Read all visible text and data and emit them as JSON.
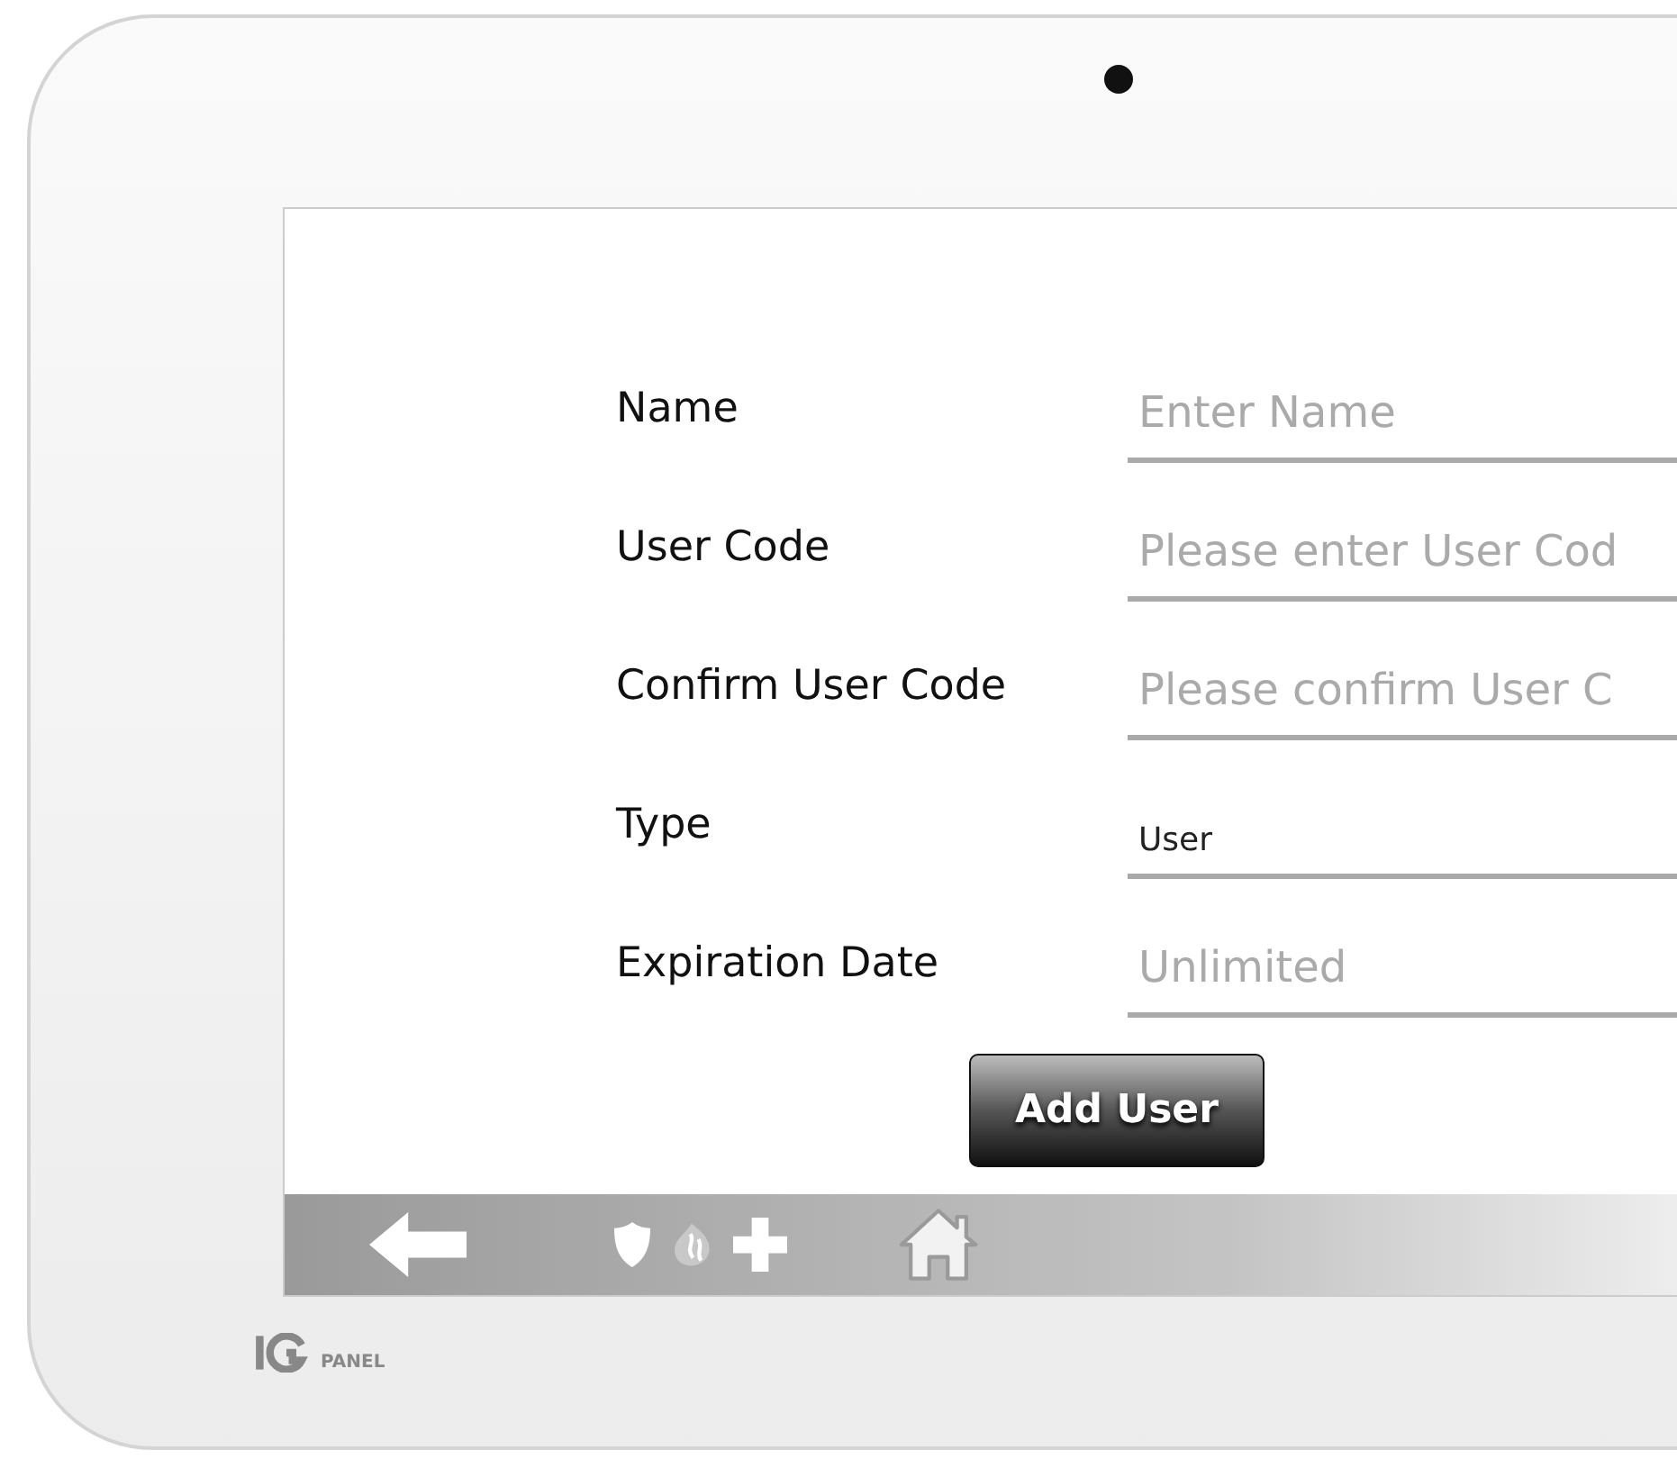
{
  "form": {
    "fields": [
      {
        "label": "Name",
        "kind": "text",
        "placeholder": "Enter Name"
      },
      {
        "label": "User Code",
        "kind": "text",
        "placeholder": "Please enter User Cod"
      },
      {
        "label": "Confirm User Code",
        "kind": "text",
        "placeholder": "Please confirm User C"
      },
      {
        "label": "Type",
        "kind": "select",
        "value": "User"
      },
      {
        "label": "Expiration Date",
        "kind": "text",
        "placeholder": "Unlimited"
      }
    ]
  },
  "button": {
    "label": "Add User"
  },
  "logo": {
    "text": "PANEL"
  }
}
